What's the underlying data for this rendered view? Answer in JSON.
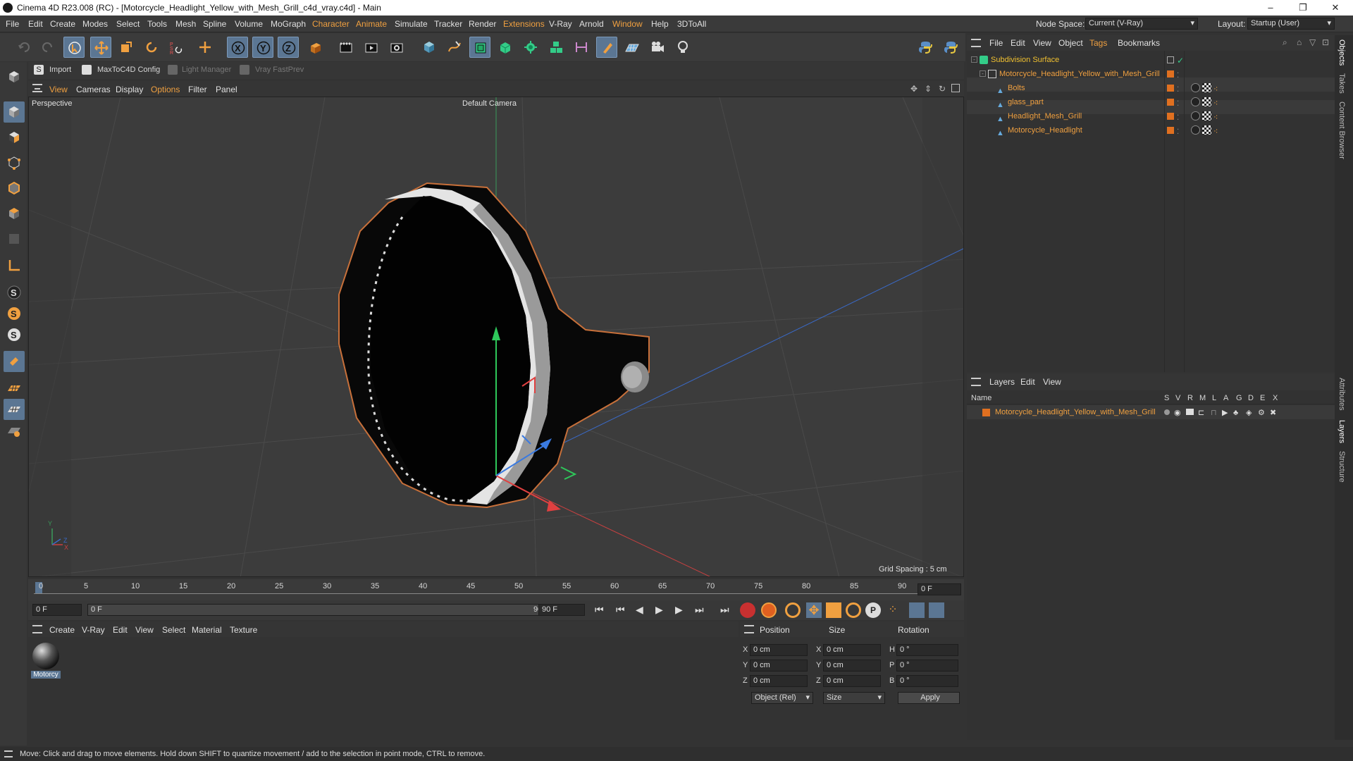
{
  "window": {
    "title": "Cinema 4D R23.008 (RC) - [Motorcycle_Headlight_Yellow_with_Mesh_Grill_c4d_vray.c4d] - Main",
    "minimize": "–",
    "maximize": "❐",
    "close": "✕"
  },
  "menubar": {
    "items": [
      "File",
      "Edit",
      "Create",
      "Modes",
      "Select",
      "Tools",
      "Mesh",
      "Spline",
      "Volume",
      "MoGraph",
      "Character",
      "Animate",
      "Simulate",
      "Tracker",
      "Render",
      "Extensions",
      "V-Ray",
      "Arnold",
      "Window",
      "Help",
      "3DToAll"
    ],
    "node_space_label": "Node Space:",
    "node_space_value": "Current (V-Ray)",
    "layout_label": "Layout:",
    "layout_value": "Startup (User)"
  },
  "plugin_bar": {
    "import": "Import",
    "maxtoc4d": "MaxToC4D Config",
    "light_manager": "Light Manager",
    "vray_fastprev": "Vray FastPrev"
  },
  "viewport": {
    "menu": [
      "View",
      "Cameras",
      "Display",
      "Options",
      "Filter",
      "Panel"
    ],
    "label": "Perspective",
    "camera": "Default Camera",
    "grid_spacing": "Grid Spacing : 5 cm",
    "axis_y": "Y",
    "axis_z": "Z",
    "axis_x": "X"
  },
  "object_manager": {
    "menu": [
      "File",
      "Edit",
      "View",
      "Object",
      "Tags",
      "Bookmarks"
    ],
    "objects": [
      {
        "name": "Subdivision Surface",
        "level": 0
      },
      {
        "name": "Motorcycle_Headlight_Yellow_with_Mesh_Grill",
        "level": 1
      },
      {
        "name": "Bolts",
        "level": 2
      },
      {
        "name": "glass_part",
        "level": 2
      },
      {
        "name": "Headlight_Mesh_Grill",
        "level": 2
      },
      {
        "name": "Motorcycle_Headlight",
        "level": 2
      }
    ]
  },
  "layers": {
    "menu": [
      "Layers",
      "Edit",
      "View"
    ],
    "name_header": "Name",
    "columns": [
      "S",
      "V",
      "R",
      "M",
      "L",
      "A",
      "G",
      "D",
      "E",
      "X"
    ],
    "rows": [
      {
        "name": "Motorcycle_Headlight_Yellow_with_Mesh_Grill"
      }
    ]
  },
  "side_tabs": [
    "Objects",
    "Takes",
    "Content Browser",
    "Attributes",
    "Layers",
    "Structure"
  ],
  "timeline": {
    "ticks": [
      "0",
      "5",
      "10",
      "15",
      "20",
      "25",
      "30",
      "35",
      "40",
      "45",
      "50",
      "55",
      "60",
      "65",
      "70",
      "75",
      "80",
      "85",
      "90"
    ],
    "current_frame": "0 F",
    "start": "0 F",
    "range_start": "0 F",
    "range_end": "90 F",
    "end": "90 F"
  },
  "material_manager": {
    "menu": [
      "Create",
      "V-Ray",
      "Edit",
      "View",
      "Select",
      "Material",
      "Texture"
    ],
    "material_name": "Motorcy"
  },
  "coordinates": {
    "headers": [
      "Position",
      "Size",
      "Rotation"
    ],
    "rows": [
      {
        "axis": "X",
        "pos": "0 cm",
        "saxis": "X",
        "size": "0 cm",
        "raxis": "H",
        "rot": "0 °"
      },
      {
        "axis": "Y",
        "pos": "0 cm",
        "saxis": "Y",
        "size": "0 cm",
        "raxis": "P",
        "rot": "0 °"
      },
      {
        "axis": "Z",
        "pos": "0 cm",
        "saxis": "Z",
        "size": "0 cm",
        "raxis": "B",
        "rot": "0 °"
      }
    ],
    "mode": "Object (Rel)",
    "size_mode": "Size",
    "apply": "Apply"
  },
  "status": "Move: Click and drag to move elements. Hold down SHIFT to quantize movement / add to the selection in point mode, CTRL to remove.",
  "colors": {
    "accent": "#f0a040",
    "selection": "#5b7693",
    "layer_swatch": "#e07020"
  }
}
